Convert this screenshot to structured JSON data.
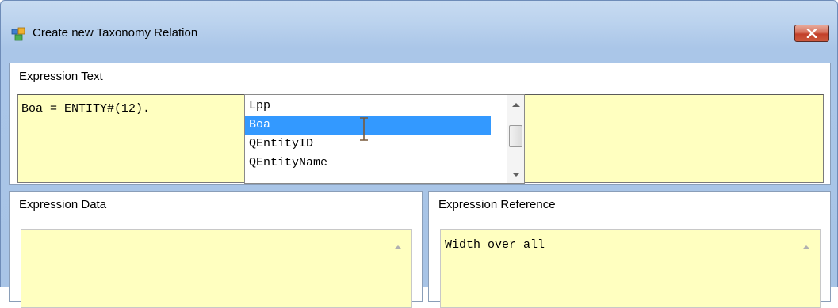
{
  "window": {
    "title": "Create new Taxonomy Relation",
    "close_glyph": "✕"
  },
  "expression_text": {
    "label": "Expression Text",
    "value": "Boa = ENTITY#(12).",
    "autocomplete": {
      "items": [
        {
          "label": "Lpp",
          "selected": false
        },
        {
          "label": "Boa",
          "selected": true
        },
        {
          "label": "QEntityID",
          "selected": false
        },
        {
          "label": "QEntityName",
          "selected": false
        }
      ]
    }
  },
  "expression_data": {
    "label": "Expression Data",
    "value": ""
  },
  "expression_reference": {
    "label": "Expression Reference",
    "value": "Width over all"
  },
  "colors": {
    "editor_background": "#ffffc0",
    "selection": "#3399ff",
    "close_button": "#c2402a",
    "title_bar": "#bcd3ee"
  },
  "icons": {
    "app": "window-app-icon",
    "close": "close-icon",
    "cursor": "ibeam-cursor-icon"
  }
}
